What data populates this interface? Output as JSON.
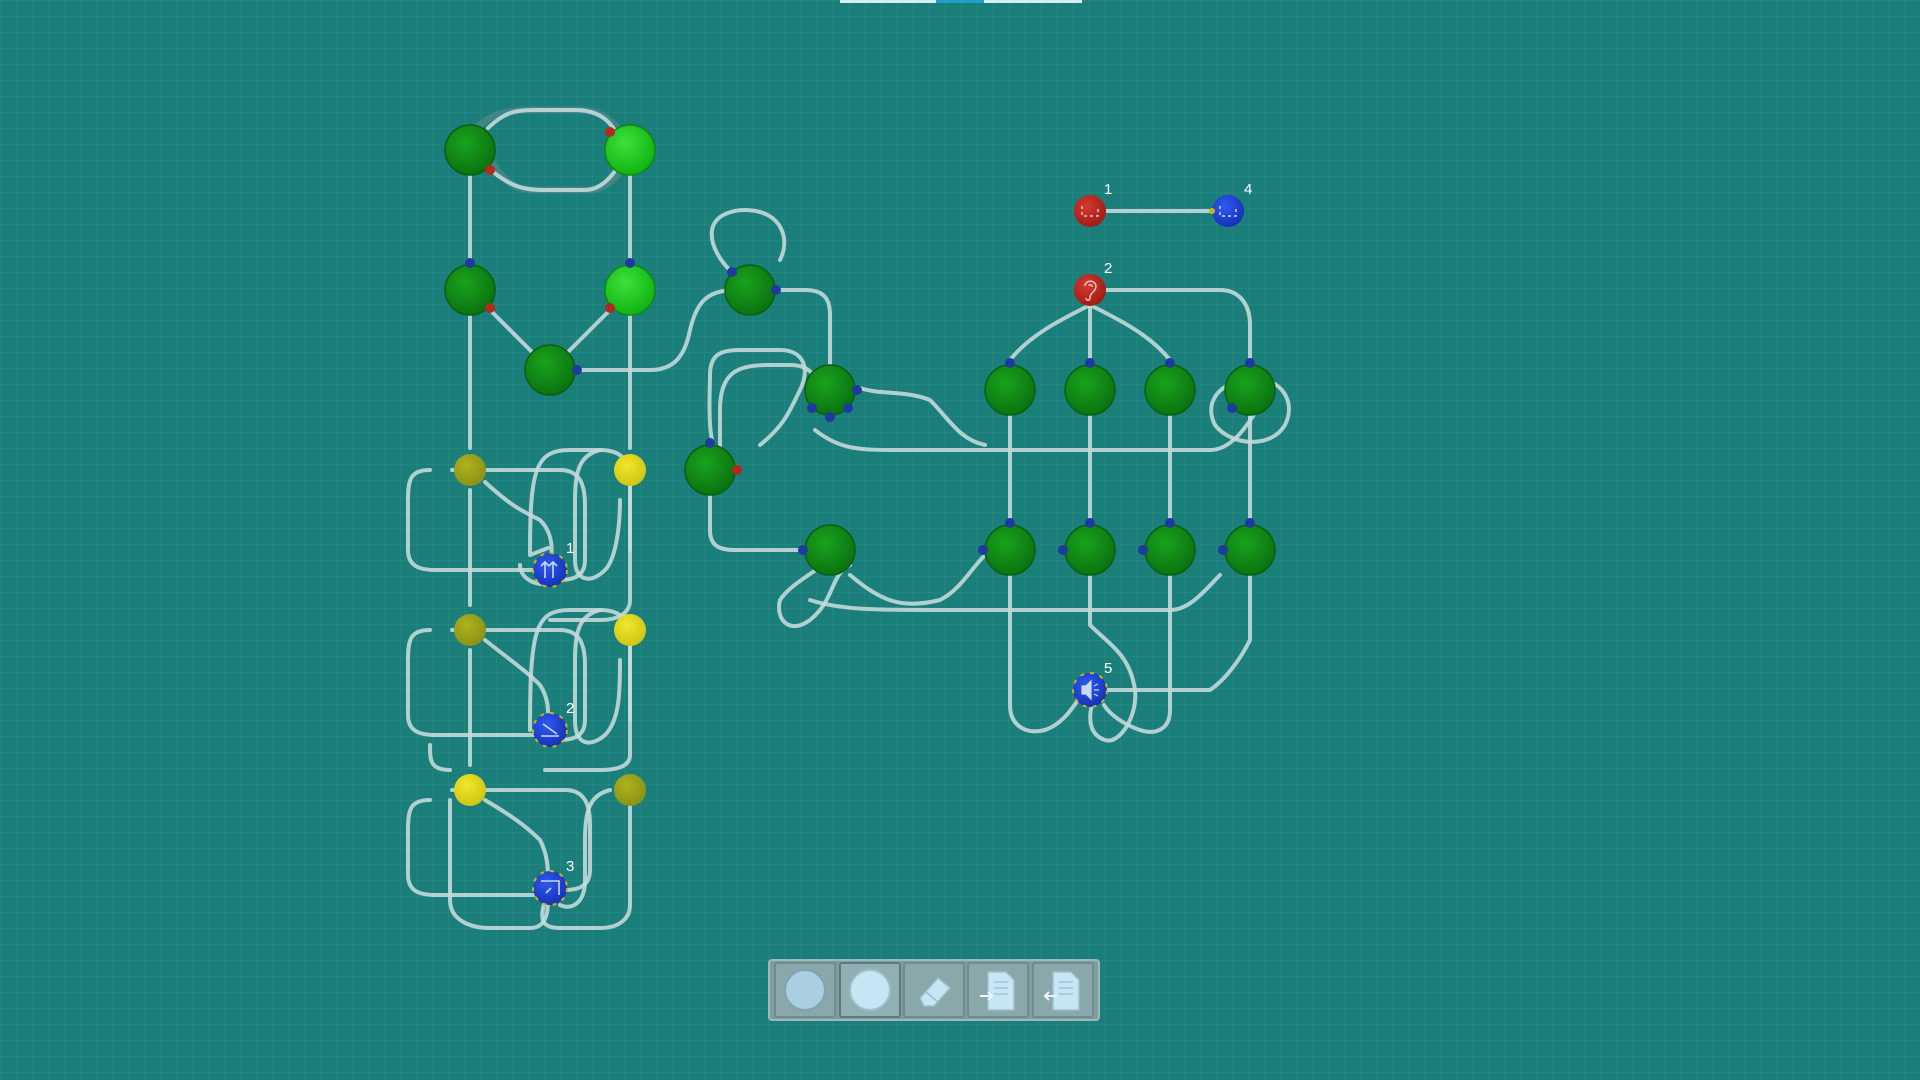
{
  "colors": {
    "background": "#1a7f7a",
    "wire": "#c4d9da",
    "gate_green": "#0e8a12",
    "gate_green_lit": "#22c722",
    "button_yellow_dim": "#9da21a",
    "button_yellow_lit": "#d8d31a",
    "io_blue": "#1f3fd0",
    "io_red": "#b8241c",
    "port_blue": "#1e3a9e",
    "port_red": "#b52820"
  },
  "io_labels": {
    "arrow": "1",
    "ramp": "2",
    "corner": "3",
    "speaker": "5",
    "red_square": "1",
    "red_ear": "2",
    "blue_square": "4"
  },
  "io_icons": {
    "arrow": "up-arrows-icon",
    "ramp": "ramp-icon",
    "corner": "corner-icon",
    "speaker": "speaker-icon",
    "red_square": "bracket-square-icon",
    "red_ear": "ear-icon",
    "blue_square": "bracket-square-icon"
  },
  "toolbar": {
    "tools": [
      {
        "name": "gate-dark-circle",
        "icon": "dark-circle-icon"
      },
      {
        "name": "gate-light-circle",
        "icon": "light-circle-icon"
      },
      {
        "name": "eraser",
        "icon": "eraser-icon"
      },
      {
        "name": "export",
        "icon": "document-export-icon"
      },
      {
        "name": "import",
        "icon": "document-import-icon"
      }
    ]
  }
}
